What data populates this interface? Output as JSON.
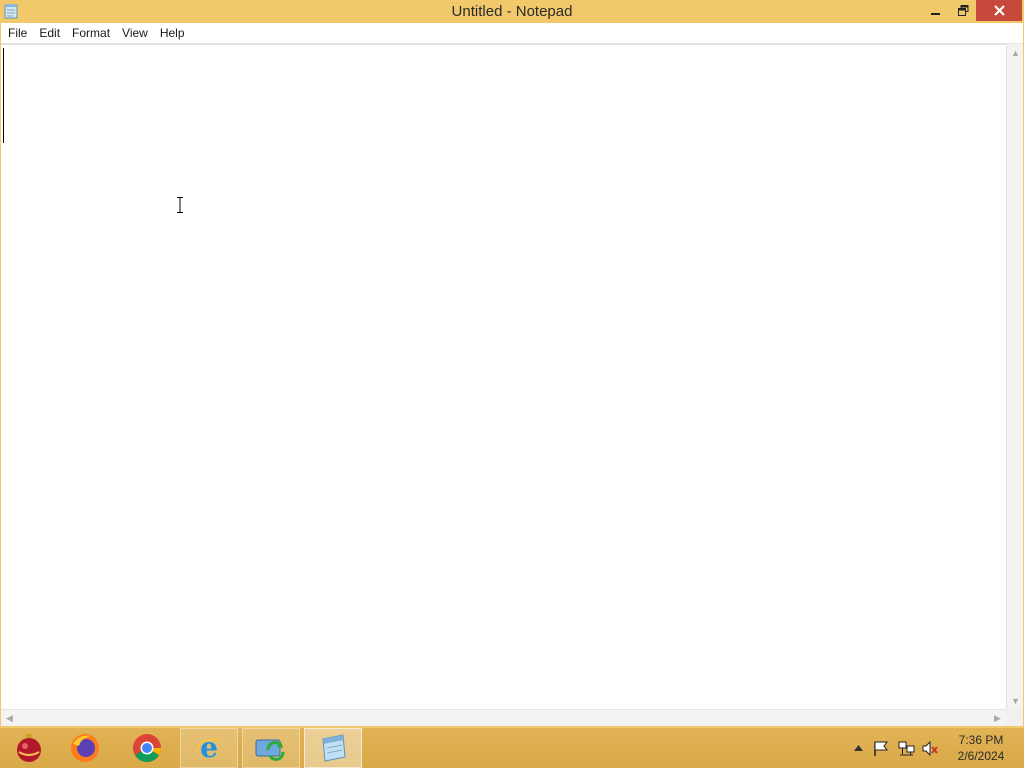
{
  "window": {
    "title": "Untitled - Notepad",
    "close_color": "#c7493d",
    "titlebar_color": "#f1c96b"
  },
  "menu": {
    "items": [
      "File",
      "Edit",
      "Format",
      "View",
      "Help"
    ]
  },
  "editor": {
    "content": ""
  },
  "taskbar": {
    "apps": [
      {
        "icon": "ornament-icon",
        "state": "pinned"
      },
      {
        "icon": "firefox-icon",
        "state": "pinned"
      },
      {
        "icon": "chrome-icon",
        "state": "pinned"
      },
      {
        "icon": "internet-explorer-icon",
        "state": "open"
      },
      {
        "icon": "sync-app-icon",
        "state": "open"
      },
      {
        "icon": "notepad-icon",
        "state": "active"
      }
    ],
    "tray_icons": [
      "show-hidden-icons-arrow",
      "action-center-flag-icon",
      "network-icon",
      "volume-muted-icon"
    ],
    "clock": {
      "time": "7:36 PM",
      "date": "2/6/2024"
    }
  }
}
